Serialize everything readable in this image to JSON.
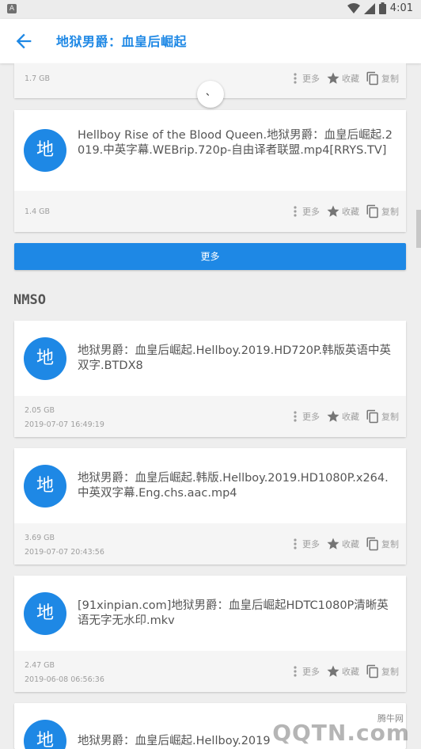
{
  "status_bar": {
    "time": "4:01"
  },
  "app_bar": {
    "title": "地狱男爵：血皇后崛起"
  },
  "card_actions": {
    "more": "更多",
    "favorite": "收藏",
    "copy": "复制"
  },
  "card_partial": {
    "size": "1.7 GB"
  },
  "cards": [
    {
      "avatar": "地",
      "name": "Hellboy Rise of the Blood Queen.地狱男爵：血皇后崛起.2019.中英字幕.WEBrip.720p-自由译者联盟.mp4[RRYS.TV]",
      "size": "1.4 GB",
      "date": ""
    },
    {
      "avatar": "地",
      "name": "地狱男爵：血皇后崛起.Hellboy.2019.HD720P.韩版英语中英双字.BTDX8",
      "size": "2.05 GB",
      "date": "2019-07-07 16:49:19"
    },
    {
      "avatar": "地",
      "name": "地狱男爵：血皇后崛起.韩版.Hellboy.2019.HD1080P.x264.中英双字幕.Eng.chs.aac.mp4",
      "size": "3.69 GB",
      "date": "2019-07-07 20:43:56"
    },
    {
      "avatar": "地",
      "name": "[91xinpian.com]地狱男爵：血皇后崛起HDTC1080P清晰英语无字无水印.mkv",
      "size": "2.47 GB",
      "date": "2019-06-08 06:56:36"
    },
    {
      "avatar": "地",
      "name": "地狱男爵：血皇后崛起.Hellboy.2019",
      "size": "",
      "date": ""
    }
  ],
  "more_button": "更多",
  "section_title": "NMSO",
  "fab_label": "、",
  "watermark": {
    "line1": "腾牛网",
    "line2": "QQTN.com"
  },
  "colors": {
    "accent": "#1e88e5",
    "background": "#eeeeee"
  }
}
